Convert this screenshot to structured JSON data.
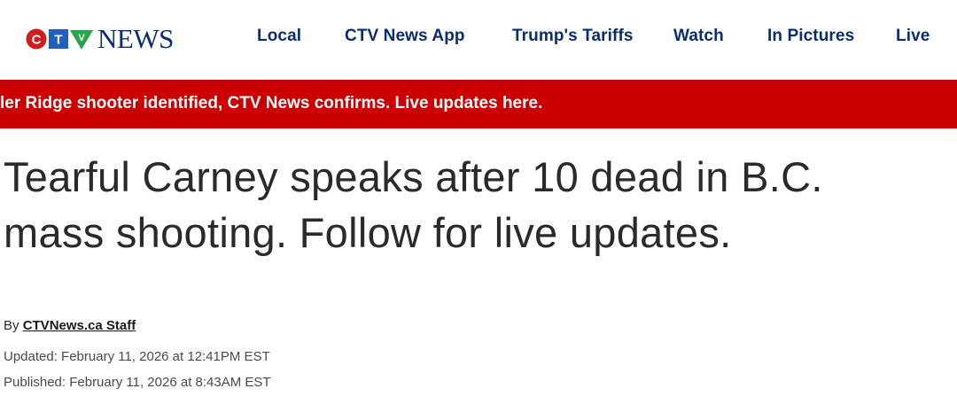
{
  "brand": {
    "logo_letters": [
      "C",
      "T",
      "V"
    ],
    "wordmark": "NEWS",
    "colors": {
      "red": "#cc1a1a",
      "blue": "#1f5fbf",
      "green": "#2aa64a",
      "navy": "#0a2e73"
    }
  },
  "nav": {
    "items": [
      {
        "label": "Local"
      },
      {
        "label": "CTV News App"
      },
      {
        "label": "Trump's Tariffs"
      },
      {
        "label": "Watch"
      },
      {
        "label": "In Pictures"
      },
      {
        "label": "Live"
      }
    ]
  },
  "breaking": {
    "text": "ler Ridge shooter identified, CTV News confirms. Live updates here.",
    "color": "#cc0000"
  },
  "article": {
    "headline": "Tearful Carney speaks after 10 dead in B.C. mass shooting. Follow for live updates.",
    "byline_prefix": "By",
    "author": "CTVNews.ca Staff",
    "updated": "Updated: February 11, 2026 at 12:41PM EST",
    "published": "Published: February 11, 2026 at 8:43AM EST"
  }
}
